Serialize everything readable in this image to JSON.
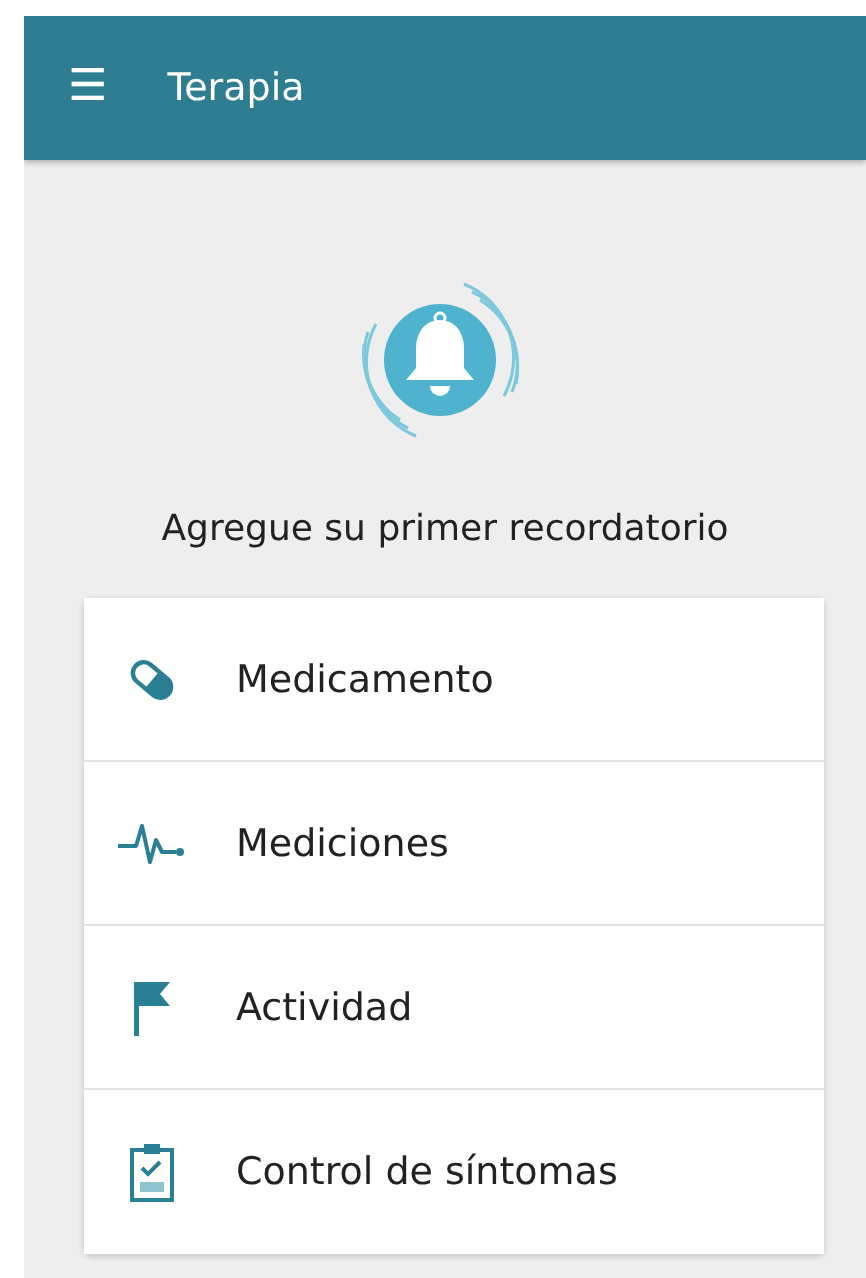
{
  "app_bar": {
    "menu_icon": "☰",
    "title": "Terapia"
  },
  "empty_state": {
    "heading": "Agregue su primer recordatorio"
  },
  "options": [
    {
      "kind": "pill",
      "label": "Medicamento"
    },
    {
      "kind": "pulse",
      "label": "Mediciones"
    },
    {
      "kind": "flag",
      "label": "Actividad"
    },
    {
      "kind": "clipboard",
      "label": "Control de síntomas"
    }
  ]
}
